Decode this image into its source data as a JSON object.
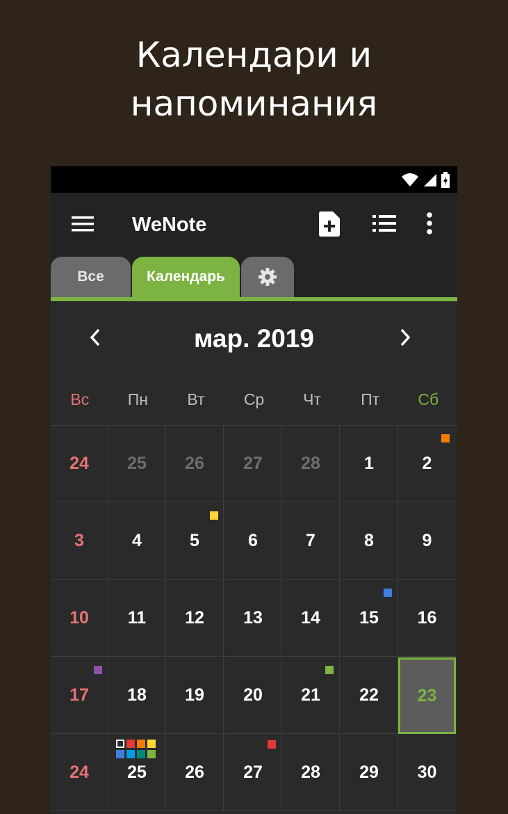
{
  "hero": {
    "line1": "Календари и",
    "line2": "напоминания"
  },
  "app": {
    "title": "WeNote"
  },
  "tabs": {
    "all": "Все",
    "calendar": "Календарь"
  },
  "calendar": {
    "month_title": "мар. 2019",
    "weekdays": [
      "Вс",
      "Пн",
      "Вт",
      "Ср",
      "Чт",
      "Пт",
      "Сб"
    ],
    "weeks": [
      [
        "24",
        "25",
        "26",
        "27",
        "28",
        "1",
        "2"
      ],
      [
        "3",
        "4",
        "5",
        "6",
        "7",
        "8",
        "9"
      ],
      [
        "10",
        "11",
        "12",
        "13",
        "14",
        "15",
        "16"
      ],
      [
        "17",
        "18",
        "19",
        "20",
        "21",
        "22",
        "23"
      ],
      [
        "24",
        "25",
        "26",
        "27",
        "28",
        "29",
        "30"
      ]
    ],
    "today": "23",
    "colors": {
      "accent": "#7cb342",
      "sunday": "#e57373",
      "orange": "#f57c00",
      "yellow": "#fdd835",
      "blue": "#3f7fe0",
      "purple": "#8e4fa8",
      "green": "#7cb342",
      "red": "#e53935",
      "teal": "#00897b",
      "cyan": "#039be5"
    }
  },
  "icons": {
    "menu": "menu-icon",
    "new_note": "new-note-icon",
    "list": "list-icon",
    "more": "more-vert-icon",
    "settings": "gear-icon",
    "prev": "chevron-left-icon",
    "next": "chevron-right-icon"
  }
}
